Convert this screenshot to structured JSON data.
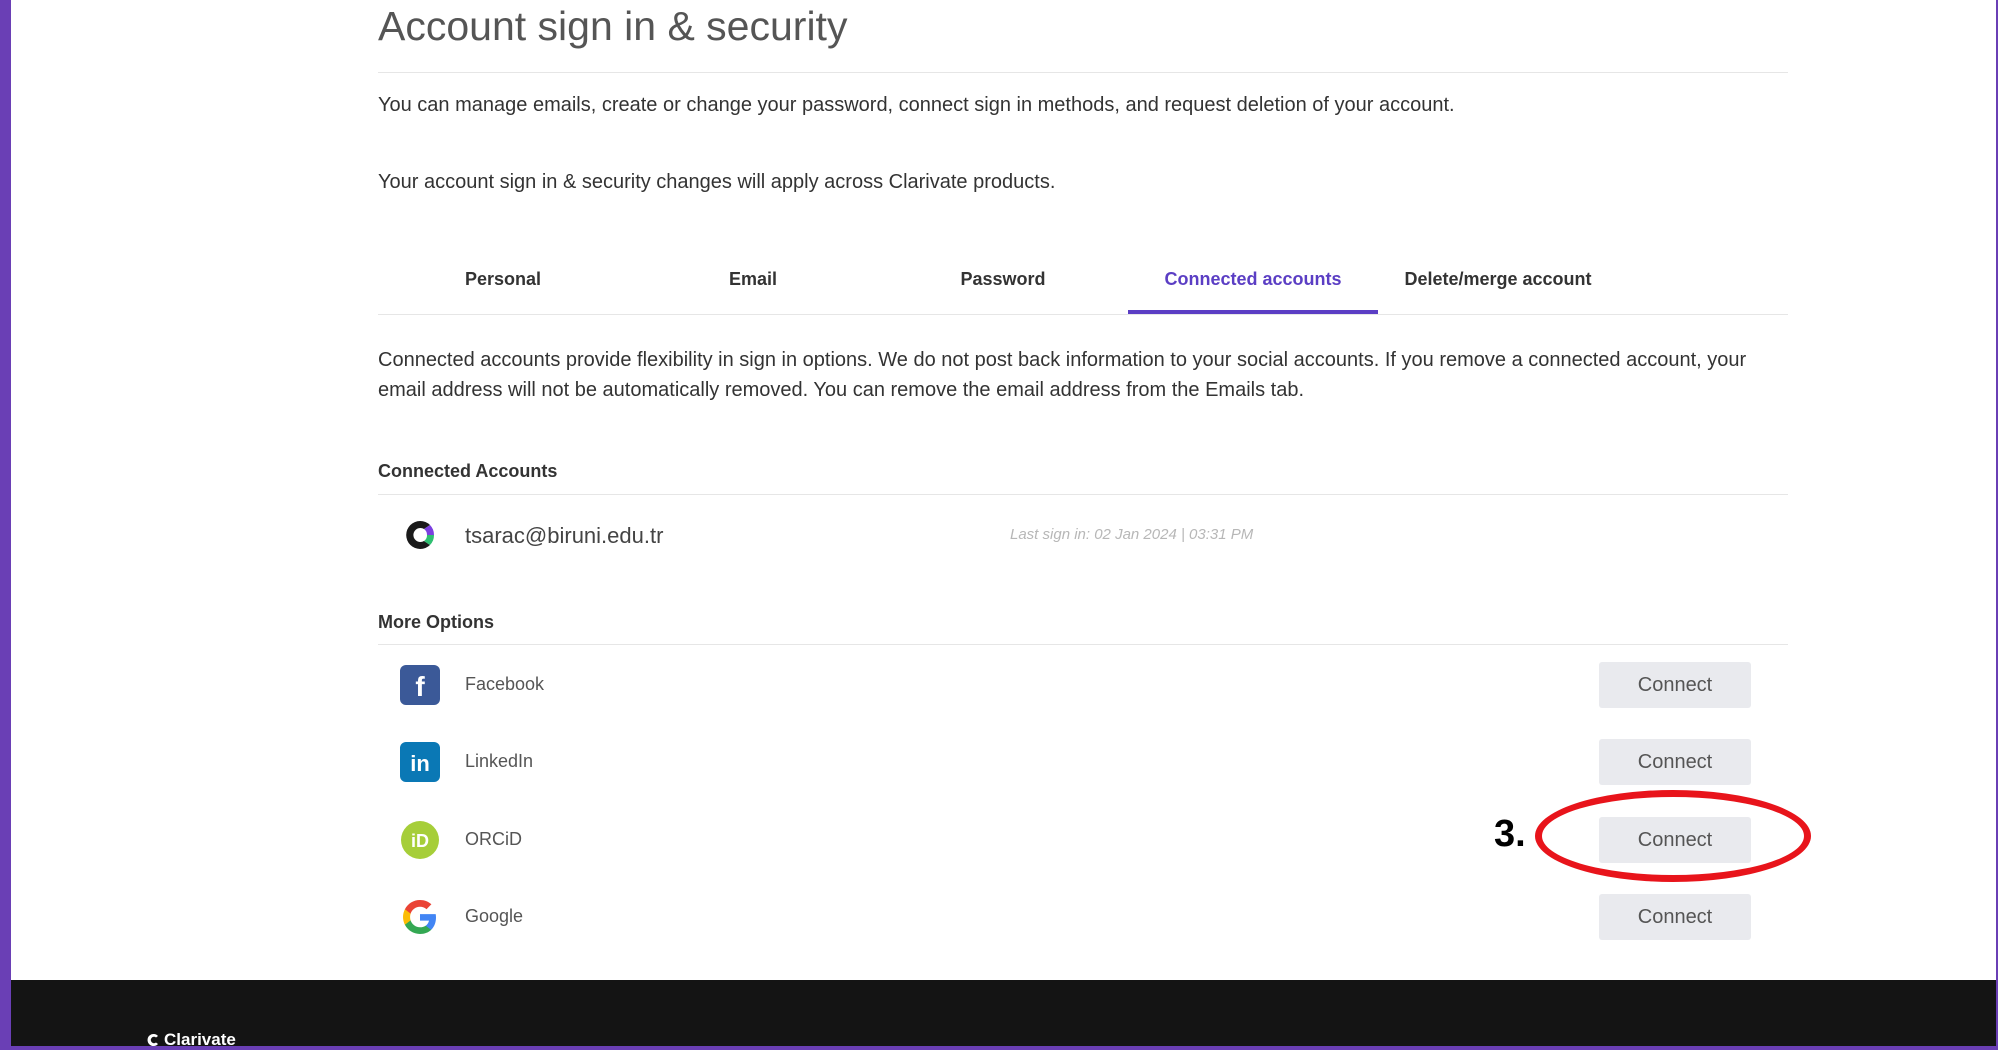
{
  "page": {
    "title": "Account sign in & security",
    "intro": "You can manage emails, create or change your password, connect sign in methods, and request deletion of your account.",
    "note": "Your account sign in & security changes will apply across Clarivate products."
  },
  "tabs": [
    {
      "label": "Personal"
    },
    {
      "label": "Email"
    },
    {
      "label": "Password"
    },
    {
      "label": "Connected accounts",
      "active": true
    },
    {
      "label": "Delete/merge account"
    }
  ],
  "connected": {
    "description": "Connected accounts provide flexibility in sign in options. We do not post back information to your social accounts. If you remove a connected account, your email address will not be automatically removed. You can remove the email address from the Emails tab.",
    "heading": "Connected Accounts",
    "account": {
      "email": "tsarac@biruni.edu.tr",
      "last_sign_in": "Last sign in: 02 Jan 2024 | 03:31 PM",
      "icon": "clarivate-icon"
    }
  },
  "more_options": {
    "heading": "More Options",
    "items": [
      {
        "label": "Facebook",
        "icon": "facebook-icon",
        "button": "Connect"
      },
      {
        "label": "LinkedIn",
        "icon": "linkedin-icon",
        "button": "Connect"
      },
      {
        "label": "ORCiD",
        "icon": "orcid-icon",
        "button": "Connect"
      },
      {
        "label": "Google",
        "icon": "google-icon",
        "button": "Connect"
      }
    ]
  },
  "annotation": {
    "number": "3."
  },
  "footer": {
    "brand": "Clarivate"
  },
  "colors": {
    "accent": "#5b3ec4",
    "annotation": "#e8141b",
    "border_purple": "#6a3fb5",
    "footer": "#141414"
  }
}
